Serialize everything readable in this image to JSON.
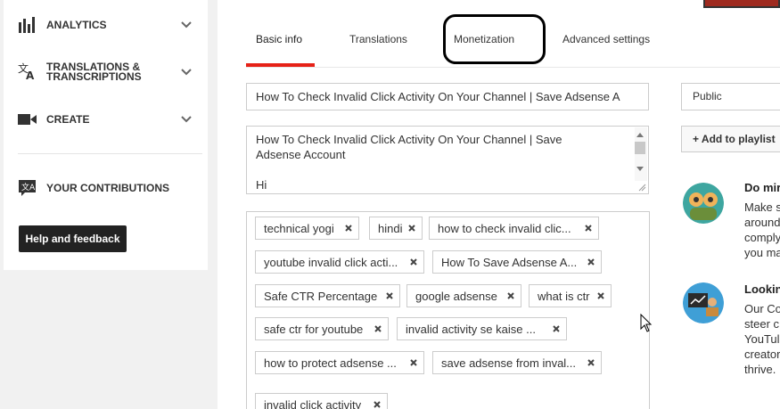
{
  "sidebar": {
    "items": [
      {
        "label": "ANALYTICS",
        "icon": "bar-chart-icon",
        "has_chevron": true
      },
      {
        "label": "TRANSLATIONS &\nTRANSCRIPTIONS",
        "icon": "translate-icon",
        "has_chevron": true
      },
      {
        "label": "CREATE",
        "icon": "video-camera-icon",
        "has_chevron": true
      },
      {
        "label": "YOUR CONTRIBUTIONS",
        "icon": "contributions-icon",
        "has_chevron": false
      }
    ],
    "help_button": "Help and feedback"
  },
  "tabs": [
    {
      "label": "Basic info",
      "active": true
    },
    {
      "label": "Translations",
      "active": false
    },
    {
      "label": "Monetization",
      "active": false
    },
    {
      "label": "Advanced settings",
      "active": false
    }
  ],
  "video": {
    "title": "How To Check Invalid Click Activity On Your Channel | Save Adsense A",
    "description": "How To Check Invalid Click Activity On Your Channel | Save\nAdsense Account\n\nHi",
    "tags": [
      "technical yogi",
      "hindi",
      "how to check invalid clic...",
      "youtube invalid click acti...",
      "How To Save Adsense A...",
      "Safe CTR Percentage",
      "google adsense",
      "what is ctr",
      "safe ctr for youtube",
      "invalid activity se kaise ...",
      "how to protect adsense ...",
      "save adsense from inval...",
      "invalid click activity"
    ]
  },
  "privacy": {
    "value": "Public"
  },
  "playlist": {
    "label": "+ Add to playlist"
  },
  "promos": [
    {
      "title": "Do mir",
      "body": "Make s\naround\ncomply\nyou ma",
      "icon": "community-people-icon"
    },
    {
      "title": "Lookin",
      "body": "Our Co\nsteer c\nYouTul\ncreator\nthrive.",
      "icon": "presentation-icon"
    }
  ],
  "colors": {
    "accent": "#e62117",
    "help_button_bg": "#222222"
  }
}
